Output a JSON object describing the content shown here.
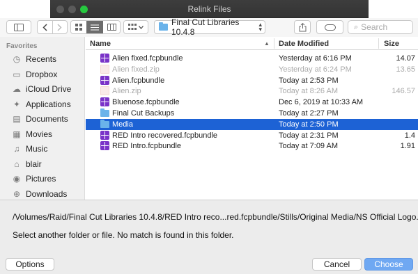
{
  "window": {
    "title": "Relink Files"
  },
  "toolbar": {
    "path_popup": "Final Cut Libraries 10.4.8",
    "search_placeholder": "Search"
  },
  "sidebar": {
    "header": "Favorites",
    "items": [
      {
        "label": "Recents",
        "icon": "recents-icon"
      },
      {
        "label": "Dropbox",
        "icon": "dropbox-icon"
      },
      {
        "label": "iCloud Drive",
        "icon": "icloud-icon"
      },
      {
        "label": "Applications",
        "icon": "applications-icon"
      },
      {
        "label": "Documents",
        "icon": "documents-icon"
      },
      {
        "label": "Movies",
        "icon": "movies-icon"
      },
      {
        "label": "Music",
        "icon": "music-icon"
      },
      {
        "label": "blair",
        "icon": "home-icon"
      },
      {
        "label": "Pictures",
        "icon": "pictures-icon"
      },
      {
        "label": "Downloads",
        "icon": "downloads-icon"
      }
    ]
  },
  "filelist": {
    "columns": {
      "name": "Name",
      "date": "Date Modified",
      "size": "Size"
    },
    "rows": [
      {
        "name": "Alien fixed.fcpbundle",
        "date": "Yesterday at 6:16 PM",
        "size": "14.07",
        "type": "bundle",
        "dim": false,
        "selected": false
      },
      {
        "name": "Alien fixed.zip",
        "date": "Yesterday at 6:24 PM",
        "size": "13.65",
        "type": "zip",
        "dim": true,
        "selected": false
      },
      {
        "name": "Alien.fcpbundle",
        "date": "Today at 2:53 PM",
        "size": "",
        "type": "bundle",
        "dim": false,
        "selected": false
      },
      {
        "name": "Alien.zip",
        "date": "Today at 8:26 AM",
        "size": "146.57",
        "type": "zip",
        "dim": true,
        "selected": false
      },
      {
        "name": "Bluenose.fcpbundle",
        "date": "Dec 6, 2019 at 10:33 AM",
        "size": "",
        "type": "bundle",
        "dim": false,
        "selected": false
      },
      {
        "name": "Final Cut Backups",
        "date": "Today at 2:27 PM",
        "size": "",
        "type": "folder",
        "dim": false,
        "selected": false
      },
      {
        "name": "Media",
        "date": "Today at 2:50 PM",
        "size": "",
        "type": "folder",
        "dim": false,
        "selected": true
      },
      {
        "name": "RED Intro recovered.fcpbundle",
        "date": "Today at 2:31 PM",
        "size": "1.4",
        "type": "bundle",
        "dim": false,
        "selected": false
      },
      {
        "name": "RED Intro.fcpbundle",
        "date": "Today at 7:09 AM",
        "size": "1.91",
        "type": "bundle",
        "dim": false,
        "selected": false
      }
    ]
  },
  "status": {
    "path": "/Volumes/Raid/Final Cut Libraries 10.4.8/RED Intro reco...red.fcpbundle/Stills/Original Media/NS Official Logo.png",
    "message": "Select another folder or file. No match is found in this folder."
  },
  "buttons": {
    "options": "Options",
    "cancel": "Cancel",
    "choose": "Choose"
  },
  "colors": {
    "selection": "#1d62d5",
    "bundle": "#7a33c8",
    "folder": "#6ab3ea",
    "choose": "#6fa8f2"
  }
}
